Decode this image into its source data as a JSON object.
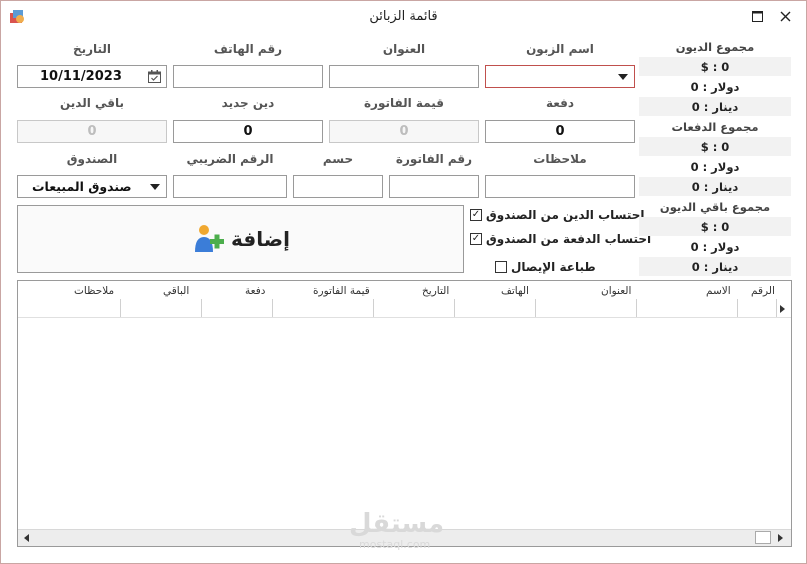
{
  "window": {
    "title": "قائمة الزبائن"
  },
  "labels": {
    "date": "التاريخ",
    "phone": "رقم الهاتف",
    "address": "العنوان",
    "customer_name": "اسم الزبون",
    "remaining_debt": "باقي الدين",
    "new_debt": "دين جديد",
    "invoice_value": "قيمة الفاتورة",
    "payment": "دفعة",
    "cashbox": "الصندوق",
    "tax_number": "الرقم الضريبي",
    "discount": "حسم",
    "invoice_number": "رقم الفاتورة",
    "notes": "ملاحظات"
  },
  "fields": {
    "date_value": "10/11/2023",
    "remaining_debt_value": "0",
    "new_debt_value": "0",
    "invoice_value_value": "0",
    "payment_value": "0",
    "cashbox_value": "صندوق المبيعات"
  },
  "options": {
    "debt_from_cashbox": "احتساب الدين من الصندوق",
    "payment_from_cashbox": "احتساب الدفعة من الصندوق",
    "print_receipt": "طباعة الإيصال"
  },
  "add_button": {
    "label": "إضافة"
  },
  "summary": {
    "debts_title": "مجموع الديون",
    "debts_usd": "$ : 0",
    "debts_dollar": "دولار : 0",
    "debts_dinar": "دينار : 0",
    "payments_title": "مجموع الدفعات",
    "payments_usd": "$ : 0",
    "payments_dollar": "دولار : 0",
    "payments_dinar": "دينار : 0",
    "remaining_title": "مجموع باقي الديون",
    "remaining_usd": "$ : 0",
    "remaining_dollar": "دولار : 0",
    "remaining_dinar": "دينار : 0"
  },
  "table": {
    "columns": [
      "الرقم",
      "الاسم",
      "العنوان",
      "الهاتف",
      "التاريخ",
      "قيمة الفاتورة",
      "دفعة",
      "الباقي",
      "ملاحظات"
    ]
  },
  "watermark": {
    "text": "مستقل",
    "sub": "mostaql.com"
  }
}
